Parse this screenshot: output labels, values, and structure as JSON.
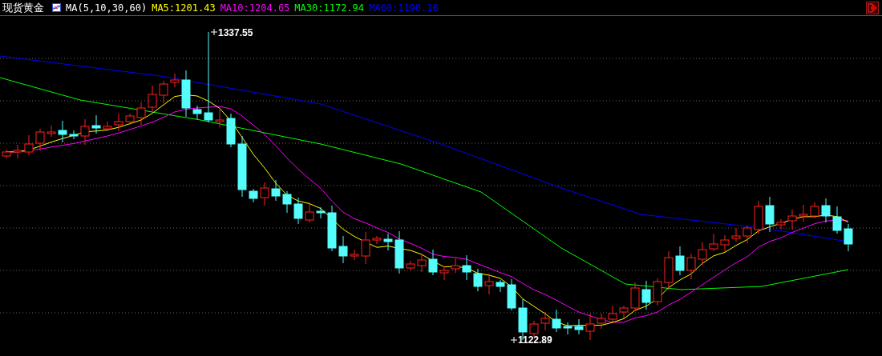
{
  "header": {
    "title": "现货黄金",
    "indicator": "MA(5,10,30,60)",
    "legend": [
      {
        "label": "MA5:1201.43",
        "color": "#ffff00"
      },
      {
        "label": "MA10:1204.65",
        "color": "#ff00ff"
      },
      {
        "label": "MA30:1172.94",
        "color": "#00ff00"
      },
      {
        "label": "MA60:1190.16",
        "color": "#0000ff"
      }
    ]
  },
  "chart": {
    "high_label": "1337.55",
    "low_label": "1122.89"
  }
}
